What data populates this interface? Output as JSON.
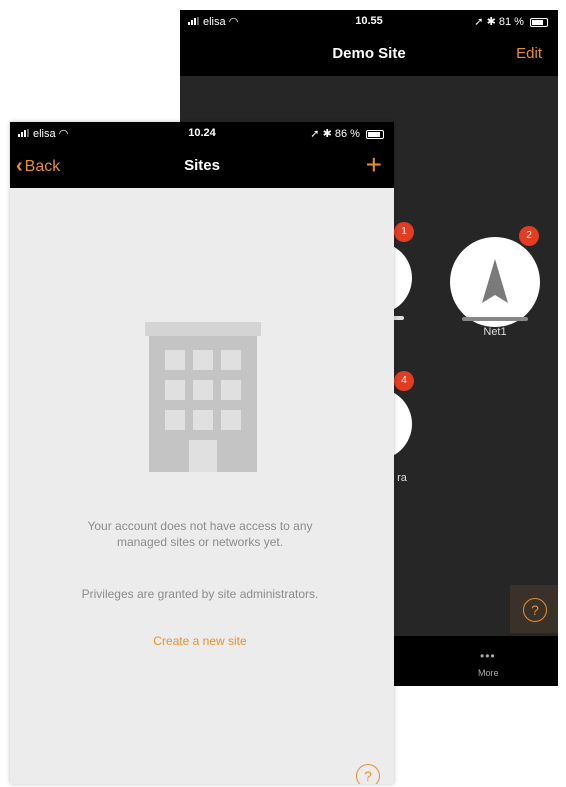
{
  "back_screen": {
    "status": {
      "carrier": "elisa",
      "time": "10.55",
      "battery": "81 %"
    },
    "title": "Demo Site",
    "edit_label": "Edit",
    "nodes": [
      {
        "badge": "1",
        "label": ""
      },
      {
        "badge": "2",
        "label": "Net1"
      },
      {
        "badge": "4",
        "label": "ra"
      }
    ],
    "help_icon": "question-circle-icon",
    "tab_more": {
      "icon": "•••",
      "label": "More"
    }
  },
  "front_screen": {
    "status": {
      "carrier": "elisa",
      "time": "10.24",
      "battery": "86 %"
    },
    "back_label": "Back",
    "title": "Sites",
    "add_icon": "+",
    "empty_message_1": "Your account does not have access to any managed sites or networks yet.",
    "empty_message_2": "Privileges are granted by site administrators.",
    "create_link": "Create a new site",
    "help_icon": "question-circle-icon"
  },
  "colors": {
    "accent": "#e8902c",
    "badge": "#e23d23",
    "dark_bg": "#262626",
    "light_bg": "#ececec"
  }
}
